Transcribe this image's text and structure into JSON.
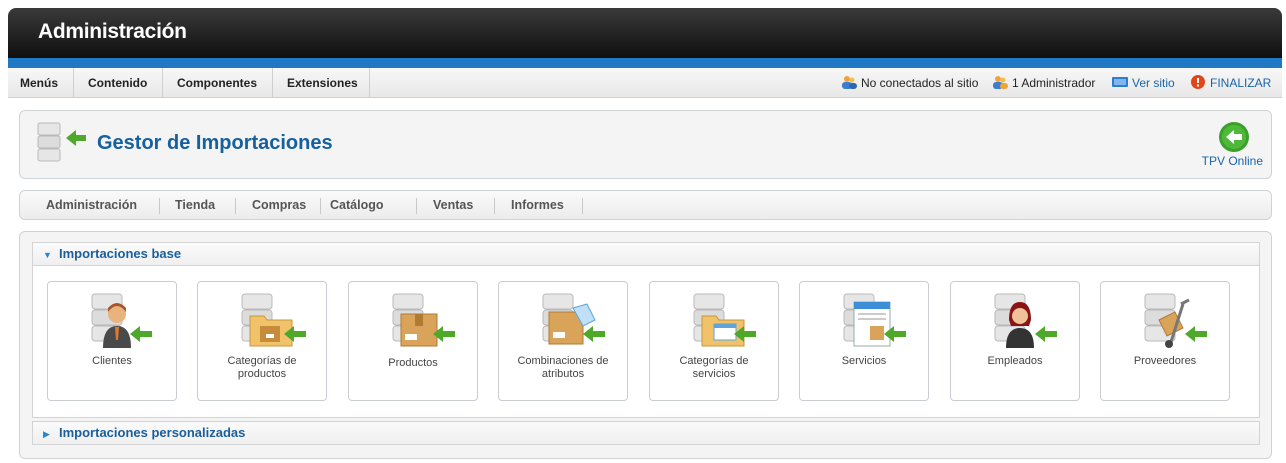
{
  "app": {
    "title": "Administración"
  },
  "menubar": {
    "menus": [
      "Menús",
      "Contenido",
      "Componentes",
      "Extensiones"
    ],
    "status_offline": "No conectados al sitio",
    "status_admins": "1 Administrador",
    "view_site": "Ver sitio",
    "logout": "FINALIZAR"
  },
  "header": {
    "title": "Gestor de Importaciones",
    "tpv_label": "TPV Online"
  },
  "subnav": [
    "Administración",
    "Tienda",
    "Compras",
    "Catálogo",
    "Ventas",
    "Informes"
  ],
  "sections": {
    "base": {
      "label": "Importaciones base",
      "expanded": true
    },
    "custom": {
      "label": "Importaciones personalizadas",
      "expanded": false
    }
  },
  "tiles": [
    {
      "line1": "Clientes",
      "line2": "",
      "icon": "person-icon"
    },
    {
      "line1": "Categorías de",
      "line2": "productos",
      "icon": "folder-box-icon"
    },
    {
      "line1": "Productos",
      "line2": "",
      "icon": "box-icon"
    },
    {
      "line1": "Combinaciones de",
      "line2": "atributos",
      "icon": "box-tag-icon"
    },
    {
      "line1": "Categorías de",
      "line2": "servicios",
      "icon": "folder-window-icon"
    },
    {
      "line1": "Servicios",
      "line2": "",
      "icon": "browser-icon"
    },
    {
      "line1": "Empleados",
      "line2": "",
      "icon": "employee-icon"
    },
    {
      "line1": "Proveedores",
      "line2": "",
      "icon": "handtruck-icon"
    }
  ],
  "colors": {
    "accent": "#1f78c3",
    "link": "#1a64a8",
    "arrow_green": "#4ea82a",
    "title_blue": "#16609e"
  }
}
